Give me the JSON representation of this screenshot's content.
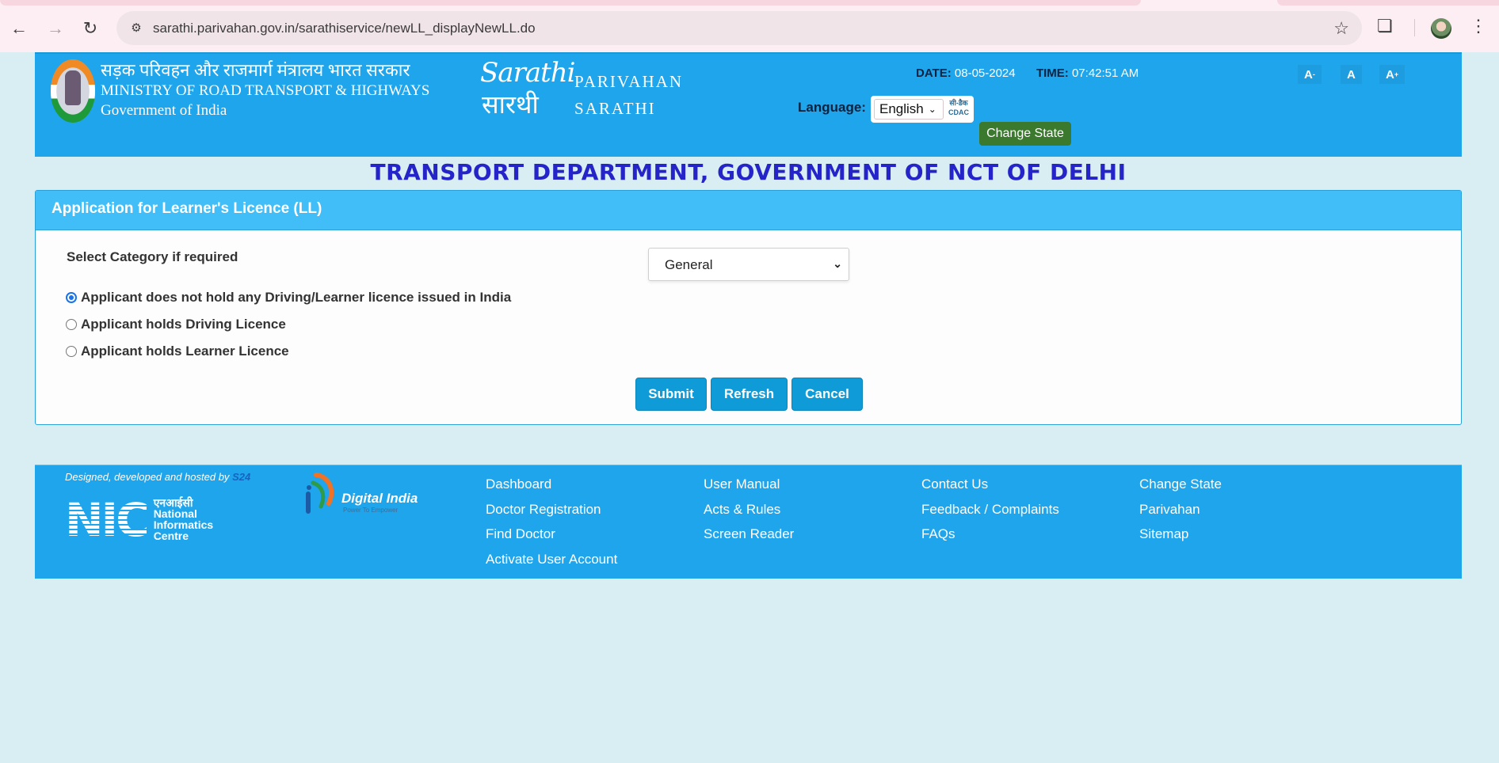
{
  "browser": {
    "url": "sarathi.parivahan.gov.in/sarathiservice/newLL_displayNewLL.do",
    "icons": [
      "back-icon",
      "forward-icon",
      "reload-icon",
      "site-info-icon",
      "bookmark-star-icon",
      "extensions-icon",
      "profile-avatar",
      "more-menu-icon"
    ]
  },
  "header": {
    "ministry_hindi": "सड़क परिवहन और राजमार्ग मंत्रालय भारत सरकार",
    "ministry_english": "MINISTRY OF ROAD TRANSPORT & HIGHWAYS",
    "government": "Government of India",
    "logo_en": "Sarathi",
    "logo_hi": "सारथी",
    "brand_line1": "PARIVAHAN",
    "brand_line2": "SARATHI",
    "date_label": "DATE:",
    "date_value": "08-05-2024",
    "time_label": "TIME:",
    "time_value": "07:42:51 AM",
    "language_label": "Language:",
    "language_selected": "English",
    "cdac_hi": "सी-डैक",
    "cdac_en": "CDAC",
    "change_state_label": "Change State",
    "font_decrease": "A",
    "font_decrease_sup": "-",
    "font_normal": "A",
    "font_increase": "A",
    "font_increase_sup": "+"
  },
  "department_title": "TRANSPORT DEPARTMENT, GOVERNMENT OF NCT OF DELHI",
  "form": {
    "title": "Application for Learner's Licence (LL)",
    "category_label": "Select Category if required",
    "category_selected": "General",
    "options": [
      {
        "label": "Applicant does not hold any Driving/Learner licence issued in India",
        "checked": true
      },
      {
        "label": "Applicant holds Driving Licence",
        "checked": false
      },
      {
        "label": "Applicant holds Learner Licence",
        "checked": false
      }
    ],
    "buttons": {
      "submit": "Submit",
      "refresh": "Refresh",
      "cancel": "Cancel"
    }
  },
  "footer": {
    "designed_by": "Designed, developed and hosted by",
    "designed_by_link": "S24",
    "nic_hindi": "एनआईसी",
    "nic_line1": "National",
    "nic_line2": "Informatics",
    "nic_line3": "Centre",
    "nic_letters": "NIC",
    "digital_india": "Digital India",
    "digital_india_tagline": "Power To Empower",
    "columns": [
      [
        "Dashboard",
        "Doctor Registration",
        "Find Doctor",
        "Activate User Account"
      ],
      [
        "User Manual",
        "Acts & Rules",
        "Screen Reader"
      ],
      [
        "Contact Us",
        "Feedback / Complaints",
        "FAQs"
      ],
      [
        "Change State",
        "Parivahan",
        "Sitemap"
      ]
    ]
  },
  "colors": {
    "header_blue": "#1ea5ec",
    "panel_head_blue": "#41bdf7",
    "button_blue": "#0f9bd7",
    "title_blue": "#2424c8",
    "change_state_green": "#3b7a2e",
    "page_bg": "#d9eef3"
  }
}
